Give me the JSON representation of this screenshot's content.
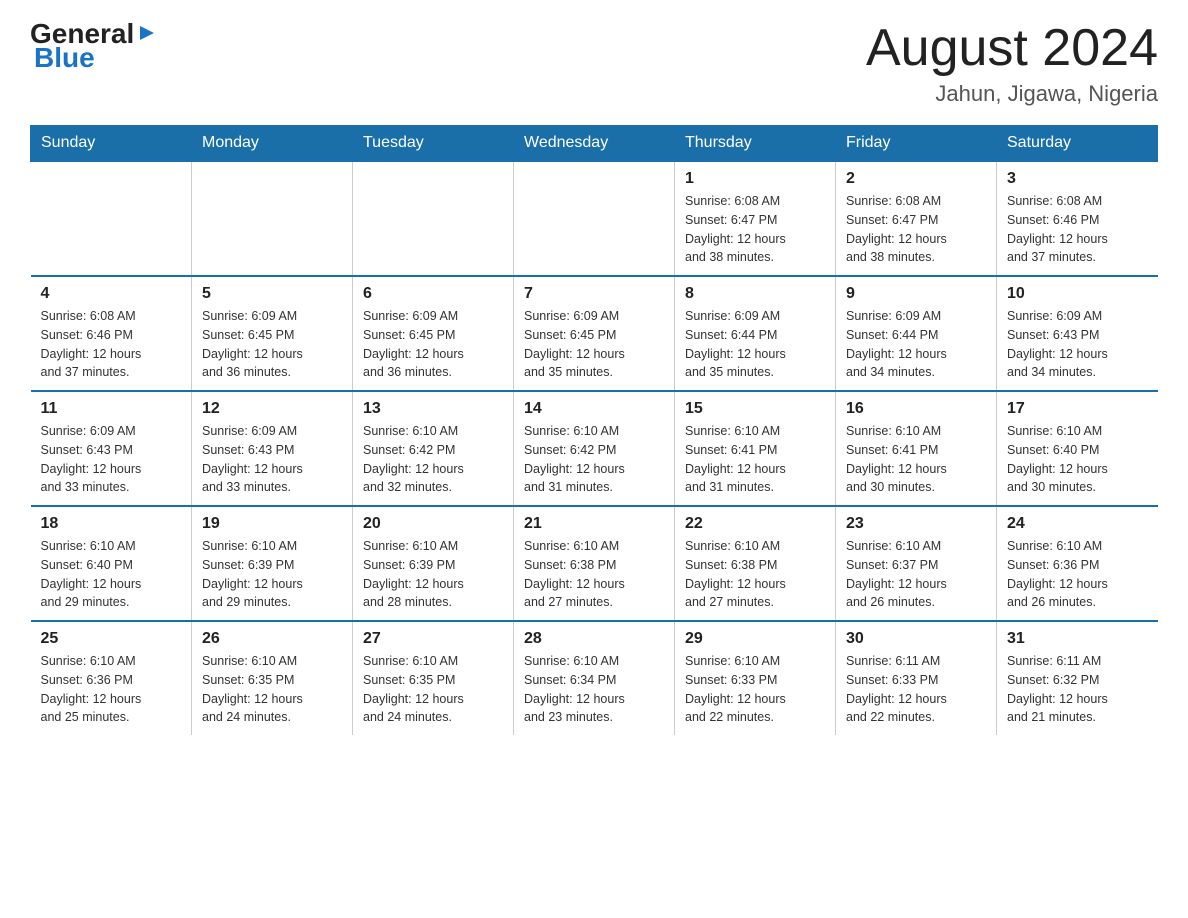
{
  "logo": {
    "general": "General",
    "arrow": "▶",
    "blue": "Blue"
  },
  "header": {
    "month": "August 2024",
    "location": "Jahun, Jigawa, Nigeria"
  },
  "weekdays": [
    "Sunday",
    "Monday",
    "Tuesday",
    "Wednesday",
    "Thursday",
    "Friday",
    "Saturday"
  ],
  "weeks": [
    [
      {
        "day": "",
        "info": ""
      },
      {
        "day": "",
        "info": ""
      },
      {
        "day": "",
        "info": ""
      },
      {
        "day": "",
        "info": ""
      },
      {
        "day": "1",
        "info": "Sunrise: 6:08 AM\nSunset: 6:47 PM\nDaylight: 12 hours\nand 38 minutes."
      },
      {
        "day": "2",
        "info": "Sunrise: 6:08 AM\nSunset: 6:47 PM\nDaylight: 12 hours\nand 38 minutes."
      },
      {
        "day": "3",
        "info": "Sunrise: 6:08 AM\nSunset: 6:46 PM\nDaylight: 12 hours\nand 37 minutes."
      }
    ],
    [
      {
        "day": "4",
        "info": "Sunrise: 6:08 AM\nSunset: 6:46 PM\nDaylight: 12 hours\nand 37 minutes."
      },
      {
        "day": "5",
        "info": "Sunrise: 6:09 AM\nSunset: 6:45 PM\nDaylight: 12 hours\nand 36 minutes."
      },
      {
        "day": "6",
        "info": "Sunrise: 6:09 AM\nSunset: 6:45 PM\nDaylight: 12 hours\nand 36 minutes."
      },
      {
        "day": "7",
        "info": "Sunrise: 6:09 AM\nSunset: 6:45 PM\nDaylight: 12 hours\nand 35 minutes."
      },
      {
        "day": "8",
        "info": "Sunrise: 6:09 AM\nSunset: 6:44 PM\nDaylight: 12 hours\nand 35 minutes."
      },
      {
        "day": "9",
        "info": "Sunrise: 6:09 AM\nSunset: 6:44 PM\nDaylight: 12 hours\nand 34 minutes."
      },
      {
        "day": "10",
        "info": "Sunrise: 6:09 AM\nSunset: 6:43 PM\nDaylight: 12 hours\nand 34 minutes."
      }
    ],
    [
      {
        "day": "11",
        "info": "Sunrise: 6:09 AM\nSunset: 6:43 PM\nDaylight: 12 hours\nand 33 minutes."
      },
      {
        "day": "12",
        "info": "Sunrise: 6:09 AM\nSunset: 6:43 PM\nDaylight: 12 hours\nand 33 minutes."
      },
      {
        "day": "13",
        "info": "Sunrise: 6:10 AM\nSunset: 6:42 PM\nDaylight: 12 hours\nand 32 minutes."
      },
      {
        "day": "14",
        "info": "Sunrise: 6:10 AM\nSunset: 6:42 PM\nDaylight: 12 hours\nand 31 minutes."
      },
      {
        "day": "15",
        "info": "Sunrise: 6:10 AM\nSunset: 6:41 PM\nDaylight: 12 hours\nand 31 minutes."
      },
      {
        "day": "16",
        "info": "Sunrise: 6:10 AM\nSunset: 6:41 PM\nDaylight: 12 hours\nand 30 minutes."
      },
      {
        "day": "17",
        "info": "Sunrise: 6:10 AM\nSunset: 6:40 PM\nDaylight: 12 hours\nand 30 minutes."
      }
    ],
    [
      {
        "day": "18",
        "info": "Sunrise: 6:10 AM\nSunset: 6:40 PM\nDaylight: 12 hours\nand 29 minutes."
      },
      {
        "day": "19",
        "info": "Sunrise: 6:10 AM\nSunset: 6:39 PM\nDaylight: 12 hours\nand 29 minutes."
      },
      {
        "day": "20",
        "info": "Sunrise: 6:10 AM\nSunset: 6:39 PM\nDaylight: 12 hours\nand 28 minutes."
      },
      {
        "day": "21",
        "info": "Sunrise: 6:10 AM\nSunset: 6:38 PM\nDaylight: 12 hours\nand 27 minutes."
      },
      {
        "day": "22",
        "info": "Sunrise: 6:10 AM\nSunset: 6:38 PM\nDaylight: 12 hours\nand 27 minutes."
      },
      {
        "day": "23",
        "info": "Sunrise: 6:10 AM\nSunset: 6:37 PM\nDaylight: 12 hours\nand 26 minutes."
      },
      {
        "day": "24",
        "info": "Sunrise: 6:10 AM\nSunset: 6:36 PM\nDaylight: 12 hours\nand 26 minutes."
      }
    ],
    [
      {
        "day": "25",
        "info": "Sunrise: 6:10 AM\nSunset: 6:36 PM\nDaylight: 12 hours\nand 25 minutes."
      },
      {
        "day": "26",
        "info": "Sunrise: 6:10 AM\nSunset: 6:35 PM\nDaylight: 12 hours\nand 24 minutes."
      },
      {
        "day": "27",
        "info": "Sunrise: 6:10 AM\nSunset: 6:35 PM\nDaylight: 12 hours\nand 24 minutes."
      },
      {
        "day": "28",
        "info": "Sunrise: 6:10 AM\nSunset: 6:34 PM\nDaylight: 12 hours\nand 23 minutes."
      },
      {
        "day": "29",
        "info": "Sunrise: 6:10 AM\nSunset: 6:33 PM\nDaylight: 12 hours\nand 22 minutes."
      },
      {
        "day": "30",
        "info": "Sunrise: 6:11 AM\nSunset: 6:33 PM\nDaylight: 12 hours\nand 22 minutes."
      },
      {
        "day": "31",
        "info": "Sunrise: 6:11 AM\nSunset: 6:32 PM\nDaylight: 12 hours\nand 21 minutes."
      }
    ]
  ]
}
